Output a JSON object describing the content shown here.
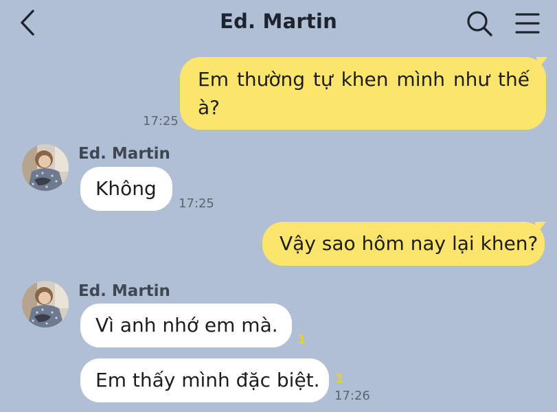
{
  "header": {
    "title": "Ed. Martin",
    "back_icon": "chevron-left-icon",
    "search_icon": "search-icon",
    "menu_icon": "hamburger-menu-icon"
  },
  "messages": [
    {
      "direction": "out",
      "text": "Em thường tự khen mình như thế à?",
      "time": "17:25"
    },
    {
      "direction": "in",
      "sender": "Ed. Martin",
      "text": "Không",
      "time": "17:25"
    },
    {
      "direction": "out",
      "text": "Vậy sao hôm nay lại khen?"
    },
    {
      "direction": "in",
      "sender": "Ed. Martin",
      "text": "Vì anh nhớ em mà.",
      "read_count": "1"
    },
    {
      "direction": "in",
      "text": "Em thấy mình đặc biệt.",
      "read_count": "1",
      "time": "17:26"
    }
  ],
  "colors": {
    "background": "#b0bfd3",
    "outgoing_bubble": "#fbe56c",
    "incoming_bubble": "#ffffff",
    "read_count": "#e9cf36"
  }
}
